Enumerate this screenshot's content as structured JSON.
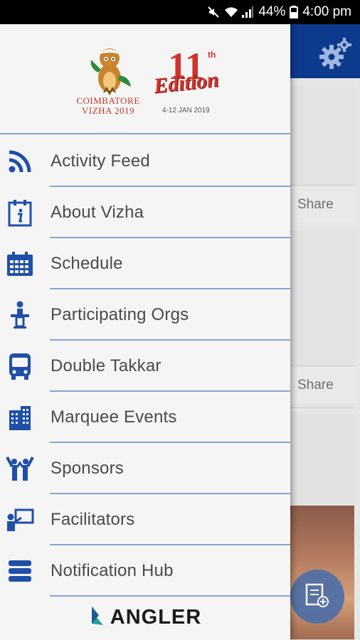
{
  "status_bar": {
    "battery": "44%",
    "time": "4:00 pm"
  },
  "background_app": {
    "share_label": "Share"
  },
  "drawer": {
    "header": {
      "vizha_logo_line1": "COIMBATORE",
      "vizha_logo_line2": "VIZHA 2019",
      "edition_number": "11",
      "edition_suffix": "th",
      "edition_word": "Edition",
      "edition_dates": "4-12 JAN 2019"
    },
    "menu": [
      {
        "label": "Activity Feed",
        "icon": "rss-icon"
      },
      {
        "label": "About Vizha",
        "icon": "info-calendar-icon"
      },
      {
        "label": "Schedule",
        "icon": "calendar-icon"
      },
      {
        "label": "Participating Orgs",
        "icon": "podium-speaker-icon"
      },
      {
        "label": "Double Takkar",
        "icon": "bus-icon"
      },
      {
        "label": "Marquee Events",
        "icon": "building-icon"
      },
      {
        "label": "Sponsors",
        "icon": "people-cheering-icon"
      },
      {
        "label": "Facilitators",
        "icon": "presenter-board-icon"
      },
      {
        "label": "Notification Hub",
        "icon": "server-stack-icon"
      }
    ],
    "footer_brand": "ANGLER"
  },
  "colors": {
    "brand_blue": "#0d3a8c",
    "icon_blue": "#1f4fa8",
    "divider": "#8aa3cf",
    "accent_red": "#d0342c"
  }
}
